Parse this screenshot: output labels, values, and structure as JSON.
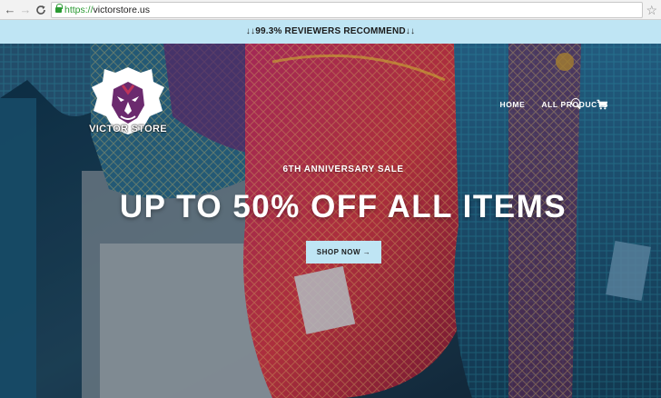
{
  "browser": {
    "url_scheme": "https://",
    "url_host": "victorstore.us",
    "nav_back": "←",
    "nav_forward": "→",
    "nav_reload": "C",
    "bookmark_star": "☆"
  },
  "announcement": {
    "text": "↓↓99.3% REVIEWERS RECOMMEND↓↓",
    "background": "#bfe5f4"
  },
  "header": {
    "logo_text": "VICTOR STORE",
    "nav": [
      {
        "label": "HOME"
      },
      {
        "label": "ALL PRODUCTS"
      }
    ],
    "icons": [
      "search-icon",
      "cart-icon"
    ]
  },
  "hero": {
    "subtitle": "6TH ANNIVERSARY SALE",
    "title": "UP TO 50% OFF ALL ITEMS",
    "button_label": "SHOP NOW →",
    "button_color": "#bfe5f4"
  }
}
